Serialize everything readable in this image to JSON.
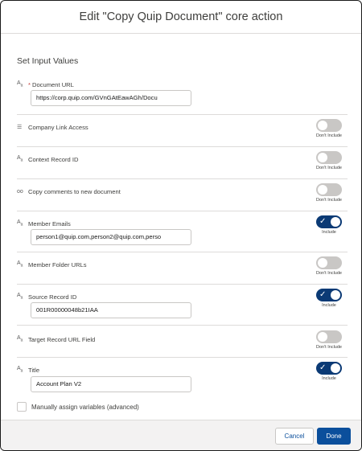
{
  "dialog": {
    "title": "Edit \"Copy Quip Document\" core action"
  },
  "section_title": "Set Input Values",
  "fields": [
    {
      "icon": "text-type-icon",
      "label": "Document URL",
      "required": true,
      "value": "https://corp.quip.com/GVnGAtEawAGh/Docu",
      "toggle": null
    },
    {
      "icon": "list-type-icon",
      "label": "Company Link Access",
      "required": false,
      "value": null,
      "toggle": "Don't Include"
    },
    {
      "icon": "text-type-icon",
      "label": "Context Record ID",
      "required": false,
      "value": null,
      "toggle": "Don't Include"
    },
    {
      "icon": "boolean-type-icon",
      "label": "Copy comments to new document",
      "required": false,
      "value": null,
      "toggle": "Don't Include"
    },
    {
      "icon": "text-type-icon",
      "label": "Member Emails",
      "required": false,
      "value": "person1@quip.com,person2@quip.com,perso",
      "toggle": "Include"
    },
    {
      "icon": "text-type-icon",
      "label": "Member Folder URLs",
      "required": false,
      "value": null,
      "toggle": "Don't Include"
    },
    {
      "icon": "text-type-icon",
      "label": "Source Record ID",
      "required": false,
      "value": "001R00000048b21IAA",
      "toggle": "Include"
    },
    {
      "icon": "text-type-icon",
      "label": "Target Record URL Field",
      "required": false,
      "value": null,
      "toggle": "Don't Include"
    },
    {
      "icon": "text-type-icon",
      "label": "Title",
      "required": false,
      "value": "Account Plan V2",
      "toggle": "Include"
    }
  ],
  "manual_assign_label": "Manually assign variables (advanced)",
  "footer": {
    "cancel_label": "Cancel",
    "done_label": "Done"
  },
  "colors": {
    "toggle_on": "#0b3a75",
    "toggle_off": "#c9c7c5",
    "brand": "#0b4f9c",
    "required": "#c23934"
  }
}
